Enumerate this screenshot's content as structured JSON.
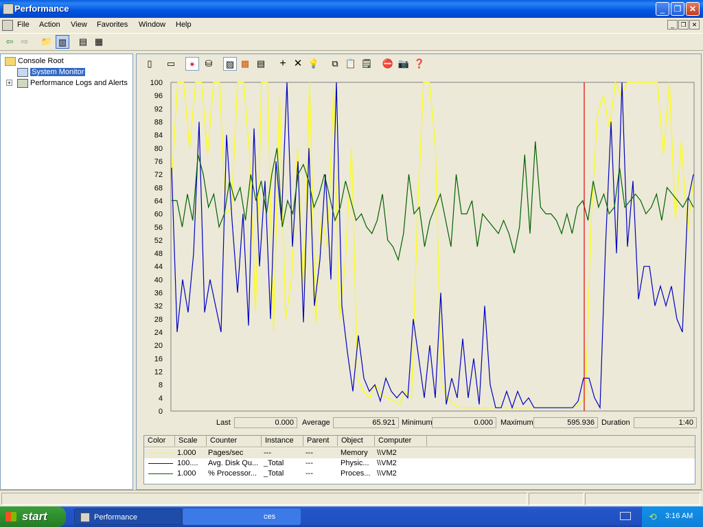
{
  "window": {
    "title": "Performance"
  },
  "menu": [
    "File",
    "Action",
    "View",
    "Favorites",
    "Window",
    "Help"
  ],
  "tree": {
    "root": "Console Root",
    "items": [
      "System Monitor",
      "Performance Logs and Alerts"
    ]
  },
  "chart_data": {
    "type": "line",
    "ylim": [
      0,
      100
    ],
    "yticks": [
      "100",
      "96",
      "92",
      "88",
      "84",
      "80",
      "76",
      "72",
      "68",
      "64",
      "60",
      "56",
      "52",
      "48",
      "44",
      "40",
      "36",
      "32",
      "28",
      "24",
      "20",
      "16",
      "12",
      "8",
      "4",
      "0"
    ],
    "marker_position": 0.79,
    "series": [
      {
        "name": "Pages/sec",
        "color": "#ffff00",
        "values": [
          70,
          100,
          100,
          80,
          100,
          100,
          78,
          100,
          100,
          60,
          62,
          100,
          100,
          78,
          30,
          100,
          100,
          24,
          96,
          28,
          40,
          80,
          36,
          100,
          26,
          60,
          50,
          98,
          28,
          46,
          80,
          10,
          6,
          4,
          8,
          5,
          4,
          3,
          2,
          6,
          4,
          60,
          100,
          100,
          80,
          8,
          4,
          2,
          1,
          1,
          1,
          1,
          1,
          1,
          1,
          1,
          1,
          1,
          1,
          1,
          1,
          1,
          1,
          1,
          1,
          1,
          1,
          1,
          2,
          4,
          60,
          90,
          96,
          86,
          100,
          96,
          100,
          100,
          100,
          100,
          100,
          100,
          78,
          100,
          58,
          82,
          54,
          70
        ]
      },
      {
        "name": "Avg. Disk Queue Length",
        "color": "#0000c0",
        "values": [
          74,
          24,
          40,
          30,
          48,
          88,
          30,
          40,
          32,
          24,
          84,
          58,
          36,
          60,
          26,
          86,
          44,
          70,
          28,
          76,
          58,
          100,
          50,
          76,
          27,
          80,
          32,
          46,
          72,
          40,
          100,
          32,
          18,
          6,
          23,
          10,
          6,
          8,
          3,
          10,
          6,
          4,
          6,
          4,
          28,
          16,
          4,
          20,
          4,
          36,
          2,
          10,
          4,
          22,
          4,
          16,
          2,
          32,
          8,
          1,
          1,
          6,
          1,
          6,
          2,
          4,
          1,
          1,
          1,
          1,
          1,
          1,
          1,
          1,
          3,
          10,
          10,
          4,
          1,
          50,
          88,
          48,
          100,
          50,
          70,
          34,
          44,
          44,
          32,
          38,
          32,
          38,
          28,
          24,
          64,
          72
        ]
      },
      {
        "name": "% Processor Time",
        "color": "#006000",
        "values": [
          64,
          64,
          56,
          66,
          58,
          78,
          72,
          62,
          66,
          56,
          60,
          70,
          64,
          68,
          58,
          72,
          64,
          70,
          60,
          72,
          80,
          56,
          64,
          60,
          72,
          75,
          70,
          62,
          66,
          72,
          65,
          58,
          62,
          70,
          64,
          58,
          60,
          56,
          54,
          58,
          66,
          52,
          50,
          46,
          54,
          72,
          60,
          62,
          50,
          58,
          62,
          66,
          58,
          50,
          72,
          60,
          60,
          64,
          50,
          60,
          58,
          56,
          54,
          58,
          54,
          48,
          56,
          78,
          54,
          82,
          62,
          60,
          60,
          58,
          54,
          60,
          54,
          62,
          64,
          58,
          70,
          62,
          66,
          60,
          62,
          74,
          62,
          64,
          66,
          64,
          60,
          62,
          66,
          58,
          68,
          66,
          64,
          62,
          65,
          62
        ]
      }
    ]
  },
  "stats": {
    "last_label": "Last",
    "last_value": "0.000",
    "average_label": "Average",
    "average_value": "65.921",
    "minimum_label": "Minimum",
    "minimum_value": "0.000",
    "maximum_label": "Maximum",
    "maximum_value": "595.936",
    "duration_label": "Duration",
    "duration_value": "1:40"
  },
  "legend": {
    "headers": [
      "Color",
      "Scale",
      "Counter",
      "Instance",
      "Parent",
      "Object",
      "Computer"
    ],
    "rows": [
      {
        "color": "#ffff00",
        "scale": "1.000",
        "counter": "Pages/sec",
        "instance": "---",
        "parent": "---",
        "object": "Memory",
        "computer": "\\\\VM2"
      },
      {
        "color": "#0000c0",
        "scale": "100....",
        "counter": "Avg. Disk Qu...",
        "instance": "_Total",
        "parent": "---",
        "object": "Physic...",
        "computer": "\\\\VM2"
      },
      {
        "color": "#006000",
        "scale": "1.000",
        "counter": "% Processor...",
        "instance": "_Total",
        "parent": "---",
        "object": "Proces...",
        "computer": "\\\\VM2"
      }
    ]
  },
  "taskbar": {
    "start_label": "start",
    "tasks": [
      "Performance",
      "ces"
    ],
    "clock": "3:16 AM"
  }
}
